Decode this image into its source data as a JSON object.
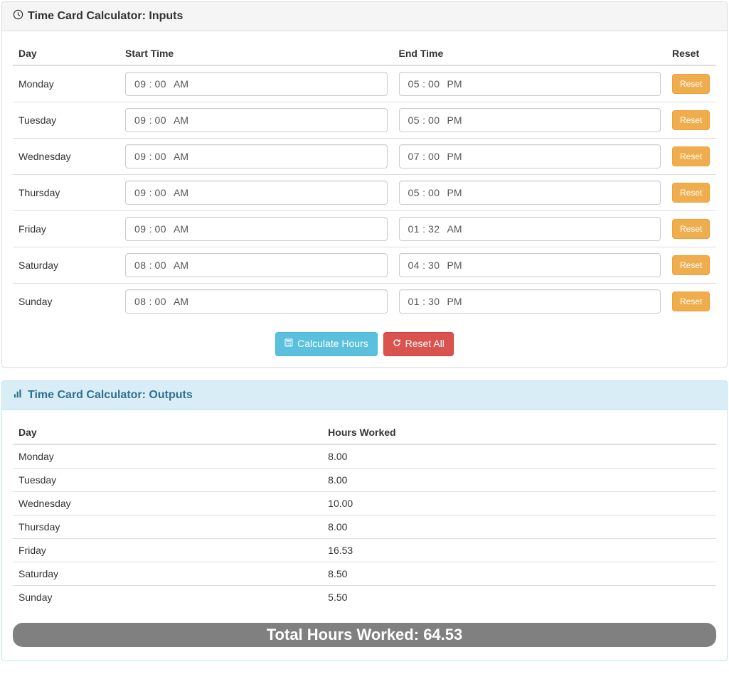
{
  "panels": {
    "inputs_title": "Time Card Calculator: Inputs",
    "outputs_title": "Time Card Calculator: Outputs"
  },
  "headers": {
    "day": "Day",
    "start_time": "Start Time",
    "end_time": "End Time",
    "reset": "Reset",
    "hours_worked": "Hours Worked"
  },
  "buttons": {
    "reset": "Reset",
    "calculate": "Calculate Hours",
    "reset_all": "Reset All"
  },
  "total_label": "Total Hours Worked:",
  "total_value": "64.53",
  "rows": [
    {
      "day": "Monday",
      "start_h": "09",
      "start_m": "00",
      "start_ap": "AM",
      "end_h": "05",
      "end_m": "00",
      "end_ap": "PM",
      "hours": "8.00"
    },
    {
      "day": "Tuesday",
      "start_h": "09",
      "start_m": "00",
      "start_ap": "AM",
      "end_h": "05",
      "end_m": "00",
      "end_ap": "PM",
      "hours": "8.00"
    },
    {
      "day": "Wednesday",
      "start_h": "09",
      "start_m": "00",
      "start_ap": "AM",
      "end_h": "07",
      "end_m": "00",
      "end_ap": "PM",
      "hours": "10.00"
    },
    {
      "day": "Thursday",
      "start_h": "09",
      "start_m": "00",
      "start_ap": "AM",
      "end_h": "05",
      "end_m": "00",
      "end_ap": "PM",
      "hours": "8.00"
    },
    {
      "day": "Friday",
      "start_h": "09",
      "start_m": "00",
      "start_ap": "AM",
      "end_h": "01",
      "end_m": "32",
      "end_ap": "AM",
      "hours": "16.53"
    },
    {
      "day": "Saturday",
      "start_h": "08",
      "start_m": "00",
      "start_ap": "AM",
      "end_h": "04",
      "end_m": "30",
      "end_ap": "PM",
      "hours": "8.50"
    },
    {
      "day": "Sunday",
      "start_h": "08",
      "start_m": "00",
      "start_ap": "AM",
      "end_h": "01",
      "end_m": "30",
      "end_ap": "PM",
      "hours": "5.50"
    }
  ]
}
